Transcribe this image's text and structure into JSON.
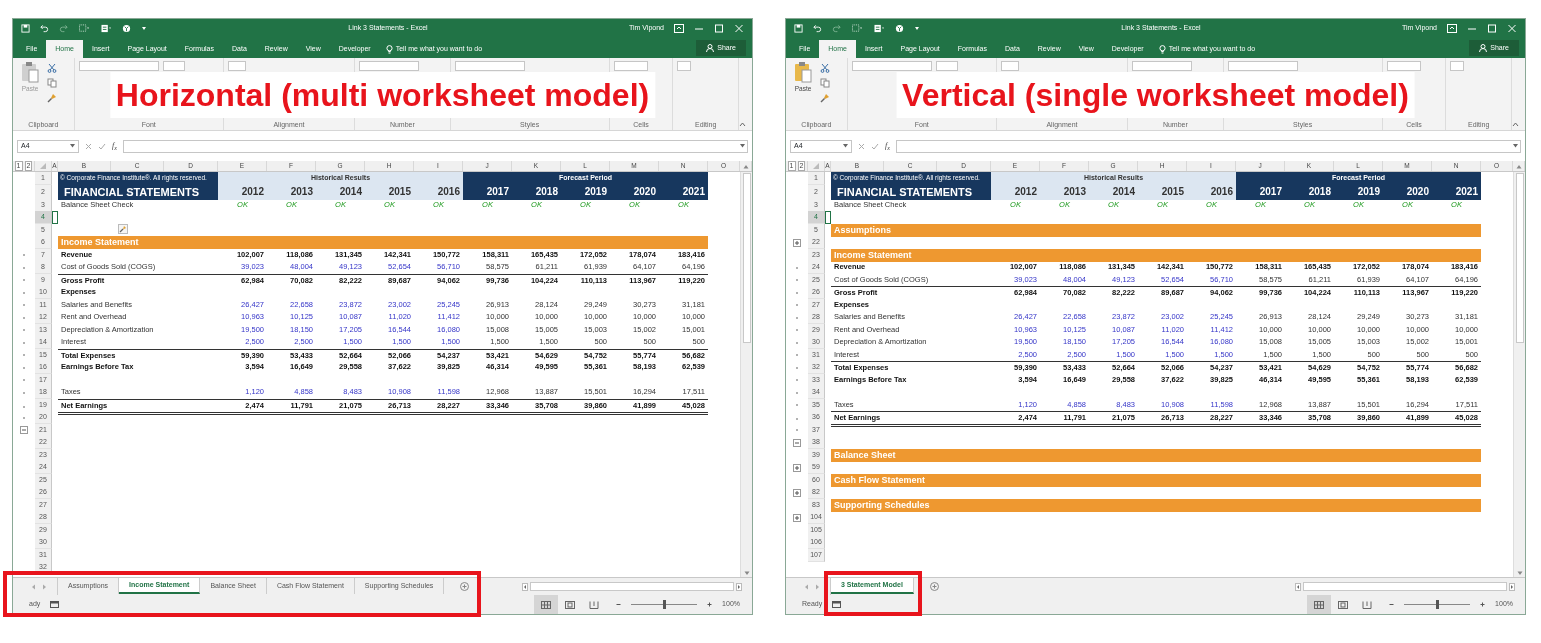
{
  "windows": [
    {
      "title": "Link 3 Statements  -  Excel",
      "user": "Tim Vipond",
      "menu_tabs": [
        {
          "label": "File",
          "selected": false
        },
        {
          "label": "Home",
          "selected": true
        },
        {
          "label": "Insert",
          "selected": false
        },
        {
          "label": "Page Layout",
          "selected": false
        },
        {
          "label": "Formulas",
          "selected": false
        },
        {
          "label": "Data",
          "selected": false
        },
        {
          "label": "Review",
          "selected": false
        },
        {
          "label": "View",
          "selected": false
        },
        {
          "label": "Developer",
          "selected": false
        }
      ],
      "tell_me": "Tell me what you want to do",
      "share": "Share",
      "paste": {
        "label": "Paste",
        "enabled": false
      },
      "ribbon_groups": [
        "Clipboard",
        "Font",
        "Alignment",
        "Number",
        "Styles",
        "Cells",
        "Editing"
      ],
      "overlay_title": "Horizontal (multi worksheet model)",
      "name_box": "A4",
      "function_label": "f$_{x}$",
      "outline_levels": [
        "1",
        "2"
      ],
      "columns": [
        "A",
        "B",
        "C",
        "D",
        "E",
        "F",
        "G",
        "H",
        "I",
        "J",
        "K",
        "L",
        "M",
        "N",
        "O"
      ],
      "rows": [
        {
          "num": "1",
          "kind": "header1",
          "label": "© Corporate Finance Institute®. All rights reserved.",
          "groups": [
            "Historical Results",
            "Forecast Period"
          ],
          "selected": false
        },
        {
          "num": "2",
          "kind": "header2",
          "label": "FINANCIAL STATEMENTS",
          "values": [
            "2012",
            "2013",
            "2014",
            "2015",
            "2016",
            "2017",
            "2018",
            "2019",
            "2020",
            "2021"
          ],
          "selected": false
        },
        {
          "num": "3",
          "kind": "check",
          "label": "Balance Sheet Check",
          "values": [
            "OK",
            "OK",
            "OK",
            "OK",
            "OK",
            "OK",
            "OK",
            "OK",
            "OK",
            "OK"
          ],
          "selected": false
        },
        {
          "num": "4",
          "kind": "blank",
          "selected": true
        },
        {
          "num": "5",
          "kind": "marker",
          "selected": false
        },
        {
          "num": "6",
          "kind": "section",
          "label": "Income Statement",
          "selected": false
        },
        {
          "num": "7",
          "kind": "item",
          "label": "Revenue",
          "bold": true,
          "input": true,
          "grouped": true,
          "values": [
            "102,007",
            "118,086",
            "131,345",
            "142,341",
            "150,772",
            "158,311",
            "165,435",
            "172,052",
            "178,074",
            "183,416"
          ],
          "selected": false
        },
        {
          "num": "8",
          "kind": "item",
          "label": "Cost of Goods Sold (COGS)",
          "bold": false,
          "input": true,
          "grouped": true,
          "values": [
            "39,023",
            "48,004",
            "49,123",
            "52,654",
            "56,710",
            "58,575",
            "61,211",
            "61,939",
            "64,107",
            "64,196"
          ],
          "selected": false
        },
        {
          "num": "9",
          "kind": "total",
          "label": "Gross Profit",
          "grouped": true,
          "values": [
            "62,984",
            "70,082",
            "82,222",
            "89,687",
            "94,062",
            "99,736",
            "104,224",
            "110,113",
            "113,967",
            "119,220"
          ],
          "selected": false
        },
        {
          "num": "10",
          "kind": "heading",
          "label": "Expenses",
          "grouped": true,
          "selected": false
        },
        {
          "num": "11",
          "kind": "item",
          "label": "Salaries and Benefits",
          "bold": false,
          "input": true,
          "grouped": true,
          "values": [
            "26,427",
            "22,658",
            "23,872",
            "23,002",
            "25,245",
            "26,913",
            "28,124",
            "29,249",
            "30,273",
            "31,181"
          ],
          "selected": false
        },
        {
          "num": "12",
          "kind": "item",
          "label": "Rent and Overhead",
          "bold": false,
          "input": true,
          "grouped": true,
          "values": [
            "10,963",
            "10,125",
            "10,087",
            "11,020",
            "11,412",
            "10,000",
            "10,000",
            "10,000",
            "10,000",
            "10,000"
          ],
          "selected": false
        },
        {
          "num": "13",
          "kind": "item",
          "label": "Depreciation & Amortization",
          "bold": false,
          "input": true,
          "grouped": true,
          "values": [
            "19,500",
            "18,150",
            "17,205",
            "16,544",
            "16,080",
            "15,008",
            "15,005",
            "15,003",
            "15,002",
            "15,001"
          ],
          "selected": false
        },
        {
          "num": "14",
          "kind": "item",
          "label": "Interest",
          "bold": false,
          "input": true,
          "grouped": true,
          "values": [
            "2,500",
            "2,500",
            "1,500",
            "1,500",
            "1,500",
            "1,500",
            "1,500",
            "500",
            "500",
            "500"
          ],
          "selected": false
        },
        {
          "num": "15",
          "kind": "total",
          "label": "Total Expenses",
          "grouped": true,
          "values": [
            "59,390",
            "53,433",
            "52,664",
            "52,066",
            "54,237",
            "53,421",
            "54,629",
            "54,752",
            "55,774",
            "56,682"
          ],
          "selected": false
        },
        {
          "num": "16",
          "kind": "item",
          "label": "Earnings Before Tax",
          "bold": true,
          "input": false,
          "grouped": true,
          "values": [
            "3,594",
            "16,649",
            "29,558",
            "37,622",
            "39,825",
            "46,314",
            "49,595",
            "55,361",
            "58,193",
            "62,539"
          ],
          "selected": false
        },
        {
          "num": "17",
          "kind": "blank",
          "grouped": true,
          "selected": false
        },
        {
          "num": "18",
          "kind": "item",
          "label": "Taxes",
          "bold": false,
          "input": true,
          "grouped": true,
          "values": [
            "1,120",
            "4,858",
            "8,483",
            "10,908",
            "11,598",
            "12,968",
            "13,887",
            "15,501",
            "16,294",
            "17,511"
          ],
          "selected": false
        },
        {
          "num": "19",
          "kind": "grand_total",
          "label": "Net Earnings",
          "grouped": true,
          "values": [
            "2,474",
            "11,791",
            "21,075",
            "26,713",
            "28,227",
            "33,346",
            "35,708",
            "39,860",
            "41,899",
            "45,028"
          ],
          "selected": false
        },
        {
          "num": "20",
          "kind": "blank",
          "grouped": true,
          "selected": false
        },
        {
          "num": "21",
          "kind": "blank",
          "expanded": true,
          "selected": false
        },
        {
          "num": "22",
          "kind": "blank",
          "selected": false
        },
        {
          "num": "23",
          "kind": "blank",
          "selected": false
        },
        {
          "num": "24",
          "kind": "blank",
          "selected": false
        },
        {
          "num": "25",
          "kind": "blank",
          "selected": false
        },
        {
          "num": "26",
          "kind": "blank",
          "selected": false
        },
        {
          "num": "27",
          "kind": "blank",
          "selected": false
        },
        {
          "num": "28",
          "kind": "blank",
          "selected": false
        },
        {
          "num": "29",
          "kind": "blank",
          "selected": false
        },
        {
          "num": "30",
          "kind": "blank",
          "selected": false
        },
        {
          "num": "31",
          "kind": "blank",
          "selected": false
        },
        {
          "num": "32",
          "kind": "blank",
          "selected": false
        }
      ],
      "sheet_tabs": [
        {
          "label": "Assumptions",
          "selected": false
        },
        {
          "label": "Income Statement",
          "selected": true
        },
        {
          "label": "Balance Sheet",
          "selected": false
        },
        {
          "label": "Cash Flow Statement",
          "selected": false
        },
        {
          "label": "Supporting Schedules",
          "selected": false
        }
      ],
      "status": "ady",
      "zoom": "100%",
      "zoom_slider": {
        "level": 0.5
      },
      "highlight": {
        "kind": "tab_bar"
      }
    },
    {
      "title": "Link 3 Statements  -  Excel",
      "user": "Tim Vipond",
      "menu_tabs": [
        {
          "label": "File",
          "selected": false
        },
        {
          "label": "Home",
          "selected": true
        },
        {
          "label": "Insert",
          "selected": false
        },
        {
          "label": "Page Layout",
          "selected": false
        },
        {
          "label": "Formulas",
          "selected": false
        },
        {
          "label": "Data",
          "selected": false
        },
        {
          "label": "Review",
          "selected": false
        },
        {
          "label": "View",
          "selected": false
        },
        {
          "label": "Developer",
          "selected": false
        }
      ],
      "tell_me": "Tell me what you want to do",
      "share": "Share",
      "paste": {
        "label": "Paste",
        "enabled": true
      },
      "ribbon_groups": [
        "Clipboard",
        "Font",
        "Alignment",
        "Number",
        "Styles",
        "Cells",
        "Editing"
      ],
      "overlay_title": "Vertical (single worksheet model)",
      "name_box": "A4",
      "function_label": "f$_{x}$",
      "outline_levels": [
        "1",
        "2"
      ],
      "columns": [
        "A",
        "B",
        "C",
        "D",
        "E",
        "F",
        "G",
        "H",
        "I",
        "J",
        "K",
        "L",
        "M",
        "N",
        "O"
      ],
      "rows": [
        {
          "num": "1",
          "kind": "header1",
          "label": "© Corporate Finance Institute®. All rights reserved.",
          "groups": [
            "Historical Results",
            "Forecast Period"
          ],
          "selected": false
        },
        {
          "num": "2",
          "kind": "header2",
          "label": "FINANCIAL STATEMENTS",
          "values": [
            "2012",
            "2013",
            "2014",
            "2015",
            "2016",
            "2017",
            "2018",
            "2019",
            "2020",
            "2021"
          ],
          "selected": false
        },
        {
          "num": "3",
          "kind": "check",
          "label": "Balance Sheet Check",
          "values": [
            "OK",
            "OK",
            "OK",
            "OK",
            "OK",
            "OK",
            "OK",
            "OK",
            "OK",
            "OK"
          ],
          "selected": false
        },
        {
          "num": "4",
          "kind": "blank",
          "selected": true
        },
        {
          "num": "5",
          "kind": "section",
          "label": "Assumptions",
          "selected": false
        },
        {
          "num": "22",
          "kind": "blank",
          "expanded": false,
          "selected": false
        },
        {
          "num": "23",
          "kind": "section",
          "label": "Income Statement",
          "selected": false
        },
        {
          "num": "24",
          "kind": "item",
          "label": "Revenue",
          "bold": true,
          "input": true,
          "grouped": true,
          "values": [
            "102,007",
            "118,086",
            "131,345",
            "142,341",
            "150,772",
            "158,311",
            "165,435",
            "172,052",
            "178,074",
            "183,416"
          ],
          "selected": false
        },
        {
          "num": "25",
          "kind": "item",
          "label": "Cost of Goods Sold (COGS)",
          "bold": false,
          "input": true,
          "grouped": true,
          "values": [
            "39,023",
            "48,004",
            "49,123",
            "52,654",
            "56,710",
            "58,575",
            "61,211",
            "61,939",
            "64,107",
            "64,196"
          ],
          "selected": false
        },
        {
          "num": "26",
          "kind": "total",
          "label": "Gross Profit",
          "grouped": true,
          "values": [
            "62,984",
            "70,082",
            "82,222",
            "89,687",
            "94,062",
            "99,736",
            "104,224",
            "110,113",
            "113,967",
            "119,220"
          ],
          "selected": false
        },
        {
          "num": "27",
          "kind": "heading",
          "label": "Expenses",
          "grouped": true,
          "selected": false
        },
        {
          "num": "28",
          "kind": "item",
          "label": "Salaries and Benefits",
          "bold": false,
          "input": true,
          "grouped": true,
          "values": [
            "26,427",
            "22,658",
            "23,872",
            "23,002",
            "25,245",
            "26,913",
            "28,124",
            "29,249",
            "30,273",
            "31,181"
          ],
          "selected": false
        },
        {
          "num": "29",
          "kind": "item",
          "label": "Rent and Overhead",
          "bold": false,
          "input": true,
          "grouped": true,
          "values": [
            "10,963",
            "10,125",
            "10,087",
            "11,020",
            "11,412",
            "10,000",
            "10,000",
            "10,000",
            "10,000",
            "10,000"
          ],
          "selected": false
        },
        {
          "num": "30",
          "kind": "item",
          "label": "Depreciation & Amortization",
          "bold": false,
          "input": true,
          "grouped": true,
          "values": [
            "19,500",
            "18,150",
            "17,205",
            "16,544",
            "16,080",
            "15,008",
            "15,005",
            "15,003",
            "15,002",
            "15,001"
          ],
          "selected": false
        },
        {
          "num": "31",
          "kind": "item",
          "label": "Interest",
          "bold": false,
          "input": true,
          "grouped": true,
          "values": [
            "2,500",
            "2,500",
            "1,500",
            "1,500",
            "1,500",
            "1,500",
            "1,500",
            "500",
            "500",
            "500"
          ],
          "selected": false
        },
        {
          "num": "32",
          "kind": "total",
          "label": "Total Expenses",
          "grouped": true,
          "values": [
            "59,390",
            "53,433",
            "52,664",
            "52,066",
            "54,237",
            "53,421",
            "54,629",
            "54,752",
            "55,774",
            "56,682"
          ],
          "selected": false
        },
        {
          "num": "33",
          "kind": "item",
          "label": "Earnings Before Tax",
          "bold": true,
          "input": false,
          "grouped": true,
          "values": [
            "3,594",
            "16,649",
            "29,558",
            "37,622",
            "39,825",
            "46,314",
            "49,595",
            "55,361",
            "58,193",
            "62,539"
          ],
          "selected": false
        },
        {
          "num": "34",
          "kind": "blank",
          "grouped": true,
          "selected": false
        },
        {
          "num": "35",
          "kind": "item",
          "label": "Taxes",
          "bold": false,
          "input": true,
          "grouped": true,
          "values": [
            "1,120",
            "4,858",
            "8,483",
            "10,908",
            "11,598",
            "12,968",
            "13,887",
            "15,501",
            "16,294",
            "17,511"
          ],
          "selected": false
        },
        {
          "num": "36",
          "kind": "grand_total",
          "label": "Net Earnings",
          "grouped": true,
          "values": [
            "2,474",
            "11,791",
            "21,075",
            "26,713",
            "28,227",
            "33,346",
            "35,708",
            "39,860",
            "41,899",
            "45,028"
          ],
          "selected": false
        },
        {
          "num": "37",
          "kind": "blank",
          "grouped": true,
          "selected": false
        },
        {
          "num": "38",
          "kind": "blank",
          "expanded": true,
          "selected": false
        },
        {
          "num": "39",
          "kind": "section",
          "label": "Balance Sheet",
          "selected": false
        },
        {
          "num": "59",
          "kind": "blank",
          "expanded": false,
          "selected": false
        },
        {
          "num": "60",
          "kind": "section",
          "label": "Cash Flow Statement",
          "selected": false
        },
        {
          "num": "82",
          "kind": "blank",
          "expanded": false,
          "selected": false
        },
        {
          "num": "83",
          "kind": "section",
          "label": "Supporting Schedules",
          "selected": false
        },
        {
          "num": "104",
          "kind": "blank",
          "expanded": false,
          "selected": false
        },
        {
          "num": "105",
          "kind": "blank",
          "selected": false
        },
        {
          "num": "106",
          "kind": "blank",
          "selected": false
        },
        {
          "num": "107",
          "kind": "blank",
          "selected": false
        }
      ],
      "sheet_tabs": [
        {
          "label": "3 Statement Model",
          "selected": true
        }
      ],
      "status": "Ready",
      "zoom": "100%",
      "zoom_slider": {
        "level": 0.5
      },
      "highlight": {
        "kind": "active_tab"
      }
    }
  ]
}
